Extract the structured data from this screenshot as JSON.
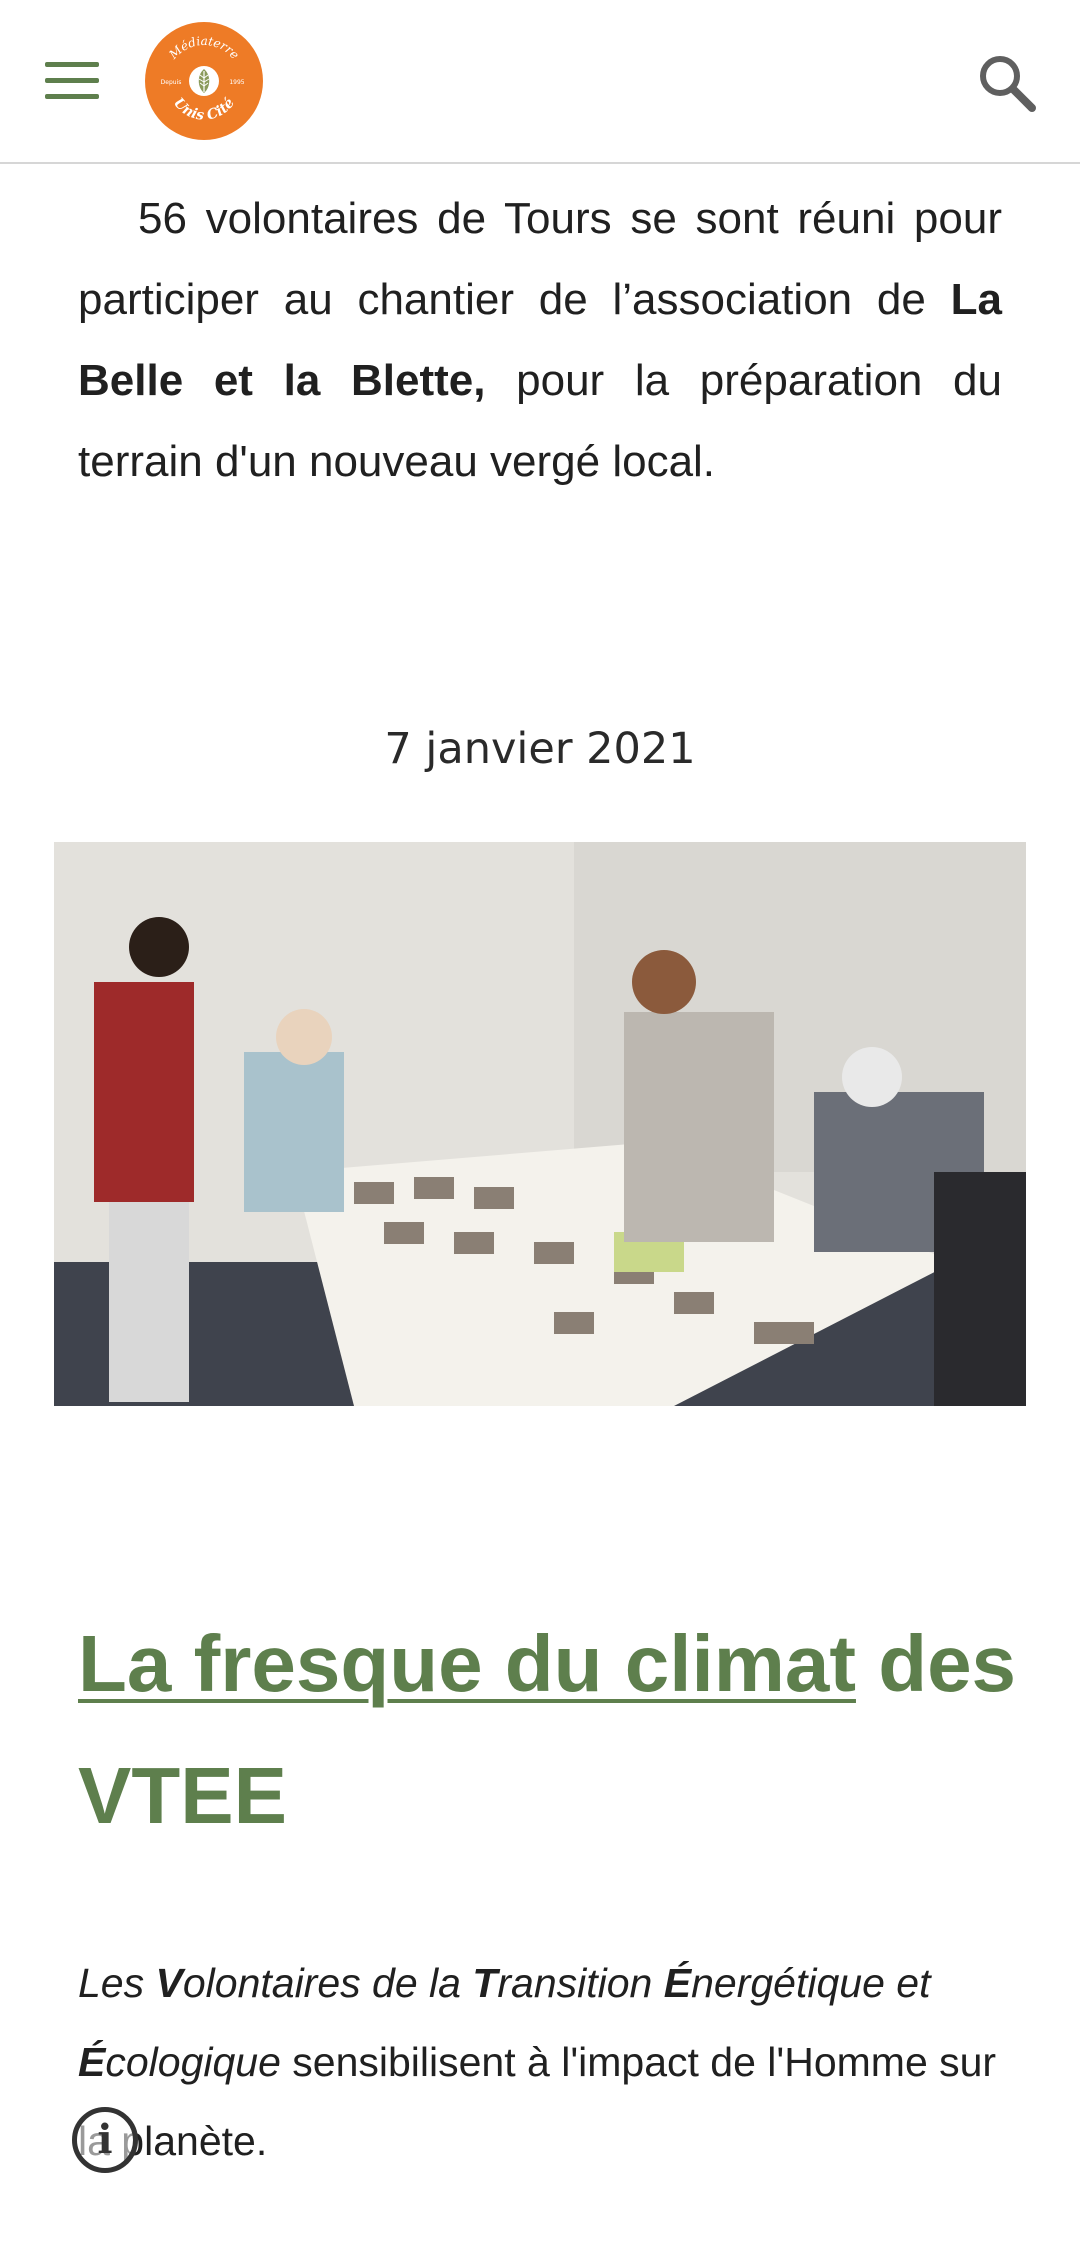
{
  "header": {
    "logo": {
      "top_text": "Médiaterre",
      "left_text": "Depuis",
      "right_text": "1995",
      "bottom_text": "Unis Cité"
    },
    "icons": {
      "menu": "menu-icon",
      "search": "search-icon",
      "info": "info-icon"
    }
  },
  "intro": {
    "part1": "56 volontaires de Tours se sont réuni pour participer au chantier de l’association de ",
    "bold": "La Belle et la Blette,",
    "part2": " pour la préparation du terrain d'un nouveau vergé local."
  },
  "article": {
    "date": "7 janvier 2021",
    "title_link": "La fresque du climat",
    "title_rest": " des VTEE",
    "body": {
      "l1": "Les ",
      "v": "V",
      "l2": "olontaires de la ",
      "t": "T",
      "l3": "ransition ",
      "e1": "É",
      "l4": "nergétique et ",
      "e2": "É",
      "l5": "cologique",
      "rest": " sensibilisent à l'impact de l'Homme sur la planète."
    }
  },
  "info_button": {
    "label": "i"
  },
  "colors": {
    "brand_green": "#5e7f4d",
    "logo_orange": "#ee7b26",
    "text": "#202020"
  }
}
